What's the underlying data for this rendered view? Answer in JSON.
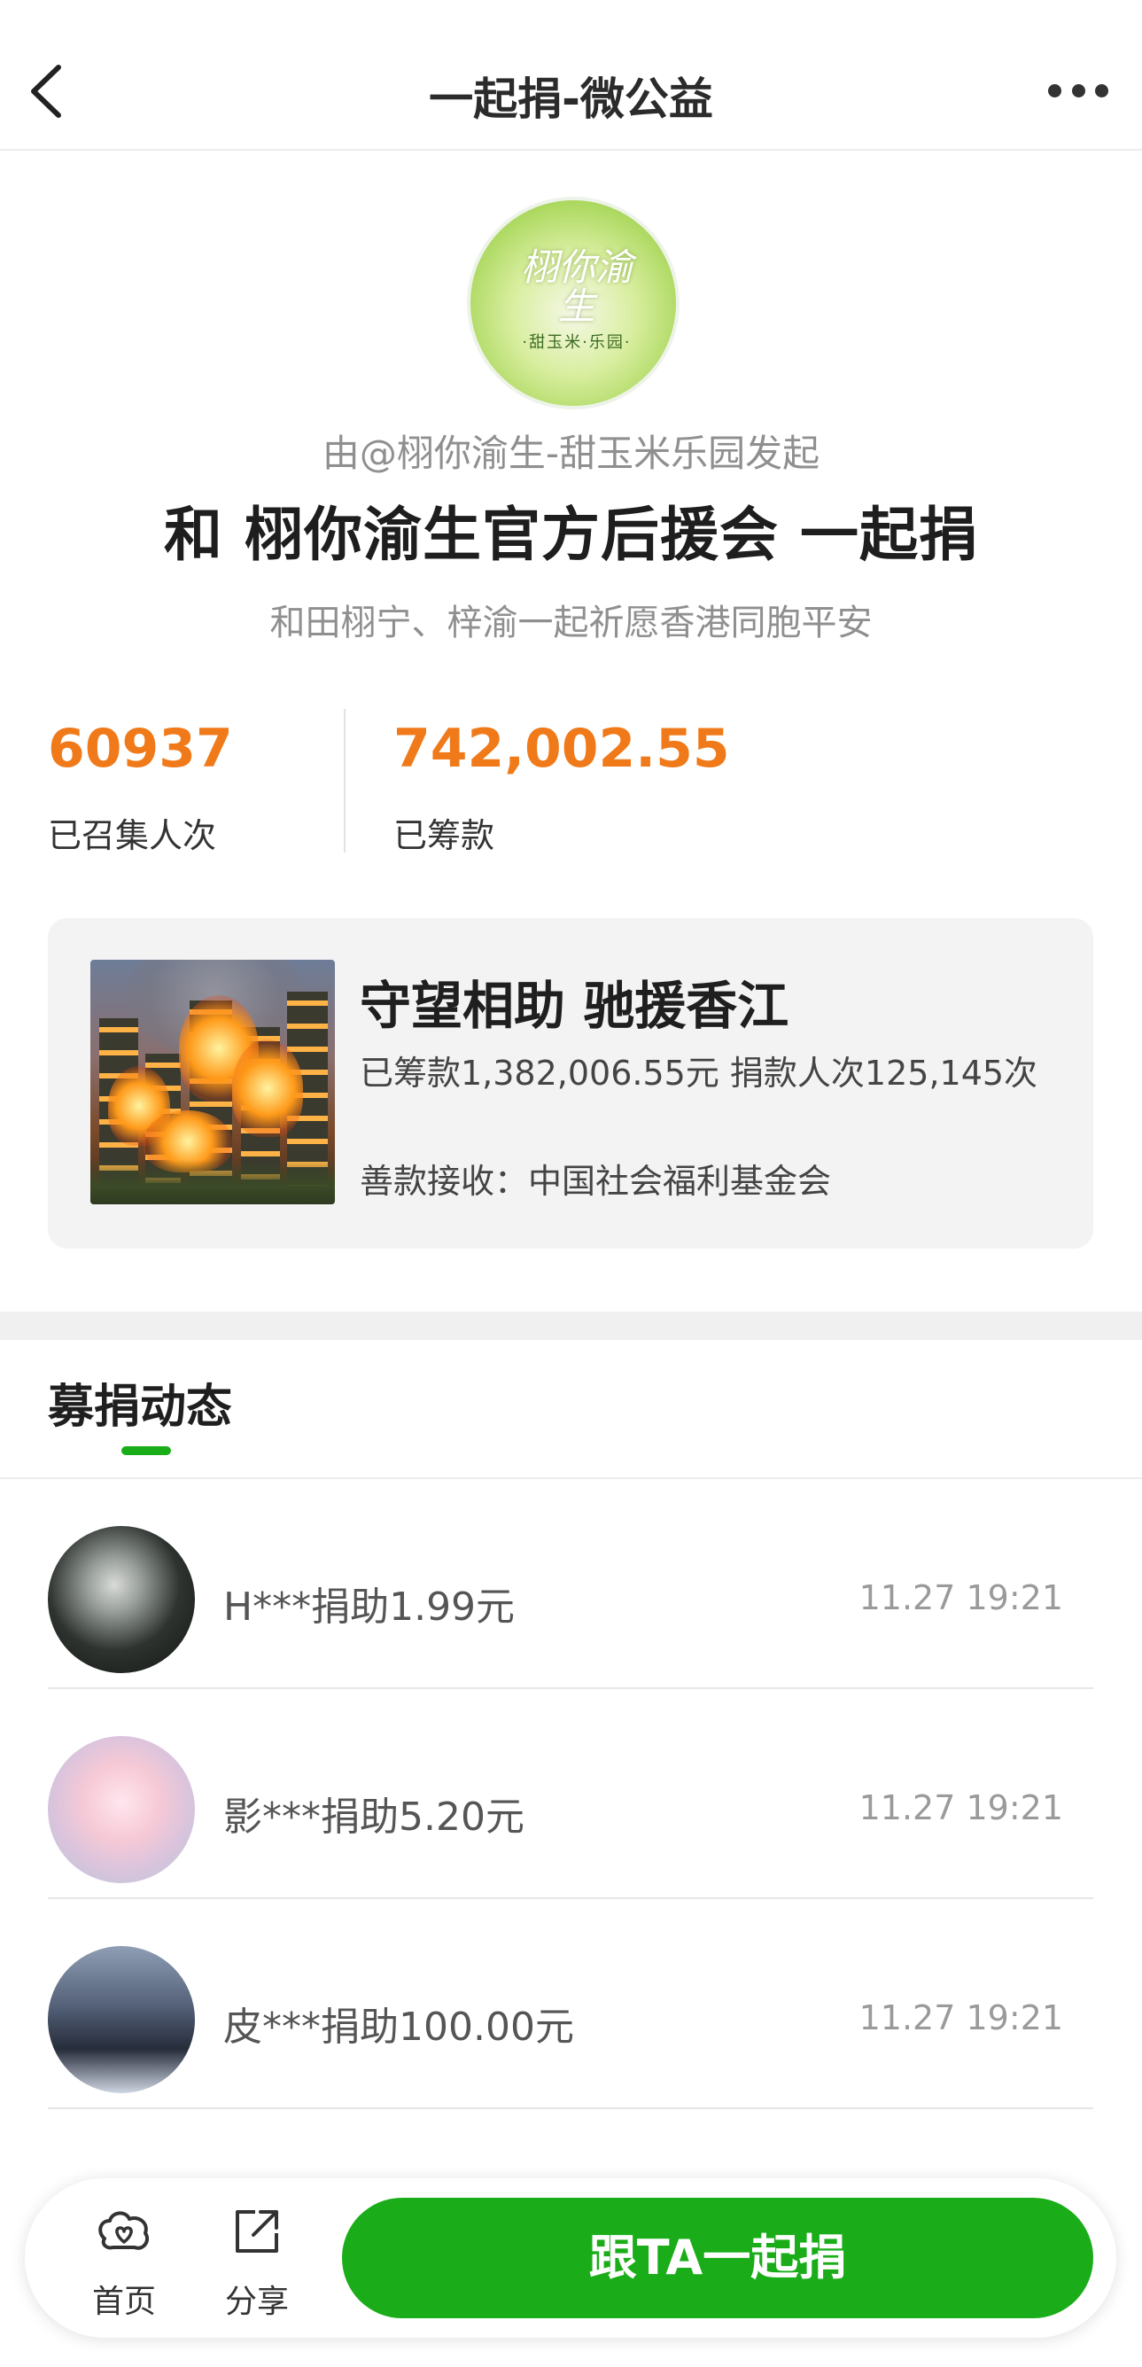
{
  "header": {
    "title": "一起捐-微公益",
    "back_icon": "chevron-left-icon",
    "more_icon": "ellipsis-icon"
  },
  "organizer": {
    "logo_text": "栩你渝生",
    "logo_subtext": "·甜玉米·乐园·",
    "initiator": "由@栩你渝生-甜玉米乐园发起",
    "title": "和 栩你渝生官方后援会 一起捐",
    "subtitle": "和田栩宁、梓渝一起祈愿香港同胞平安"
  },
  "stats": [
    {
      "value": "60937",
      "label": "已召集人次"
    },
    {
      "value": "742,002.55",
      "label": "已筹款"
    }
  ],
  "project": {
    "title": "守望相助 驰援香江",
    "stats_text": "已筹款1,382,006.55元  捐款人次125,145次",
    "receiver": "善款接收：中国社会福利基金会"
  },
  "feed": {
    "tab_label": "募捐动态",
    "items": [
      {
        "text": "H***捐助1.99元",
        "time": "11.27 19:21"
      },
      {
        "text": "影***捐助5.20元",
        "time": "11.27 19:21"
      },
      {
        "text": "皮***捐助100.00元",
        "time": "11.27 19:21"
      }
    ]
  },
  "bottom_nav": {
    "home_label": "首页",
    "share_label": "分享",
    "donate_label": "跟TA一起捐"
  },
  "colors": {
    "accent_green": "#1aad19",
    "stat_orange": "#f07a1a"
  }
}
